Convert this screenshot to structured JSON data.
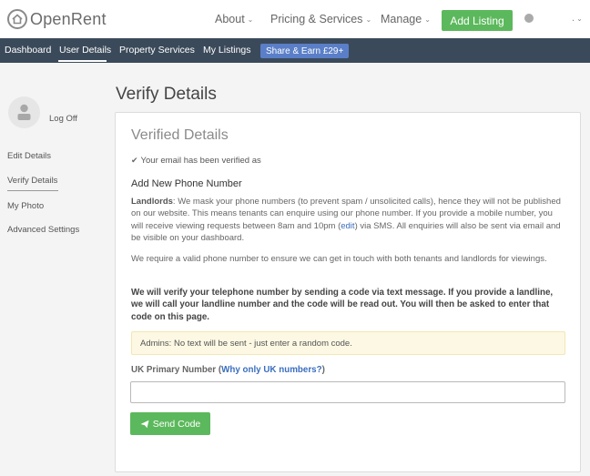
{
  "header": {
    "logo_text": "OpenRent",
    "nav": [
      {
        "label": "About"
      },
      {
        "label": "Pricing & Services"
      },
      {
        "label": "Manage"
      }
    ],
    "add_listing_label": "Add Listing",
    "user_menu_label": "."
  },
  "subnav": {
    "items": [
      "Dashboard",
      "User Details",
      "Property Services",
      "My Listings"
    ],
    "share_label": "Share & Earn £29+",
    "active": "User Details"
  },
  "sidebar": {
    "logoff_label": "Log Off",
    "links": [
      "Edit Details",
      "Verify Details",
      "My Photo",
      "Advanced Settings"
    ],
    "active": "Verify Details"
  },
  "main": {
    "page_title": "Verify Details",
    "section_title": "Verified Details",
    "email_verified": "Your email has been verified as",
    "add_phone_title": "Add New Phone Number",
    "landlords_label": "Landlords",
    "landlords_text_1": ": We mask your phone numbers (to prevent spam / unsolicited calls), hence they will not be published on our website. This means tenants can enquire using our phone number. If you provide a mobile number, you will receive viewing requests between 8am and 10pm (",
    "edit_link": "edit",
    "landlords_text_2": ") via SMS. All enquiries will also be sent via email and be visible on your dashboard.",
    "require_text": "We require a valid phone number to ensure we can get in touch with both tenants and landlords for viewings.",
    "verify_text": "We will verify your telephone number by sending a code via text message. If you provide a landline, we will call your landline number and the code will be read out. You will then be asked to enter that code on this page.",
    "admin_notice": "Admins: No text will be sent - just enter a random code.",
    "field_label": "UK Primary Number",
    "field_link": "Why only UK numbers?",
    "phone_value": "",
    "send_label": "Send Code"
  }
}
